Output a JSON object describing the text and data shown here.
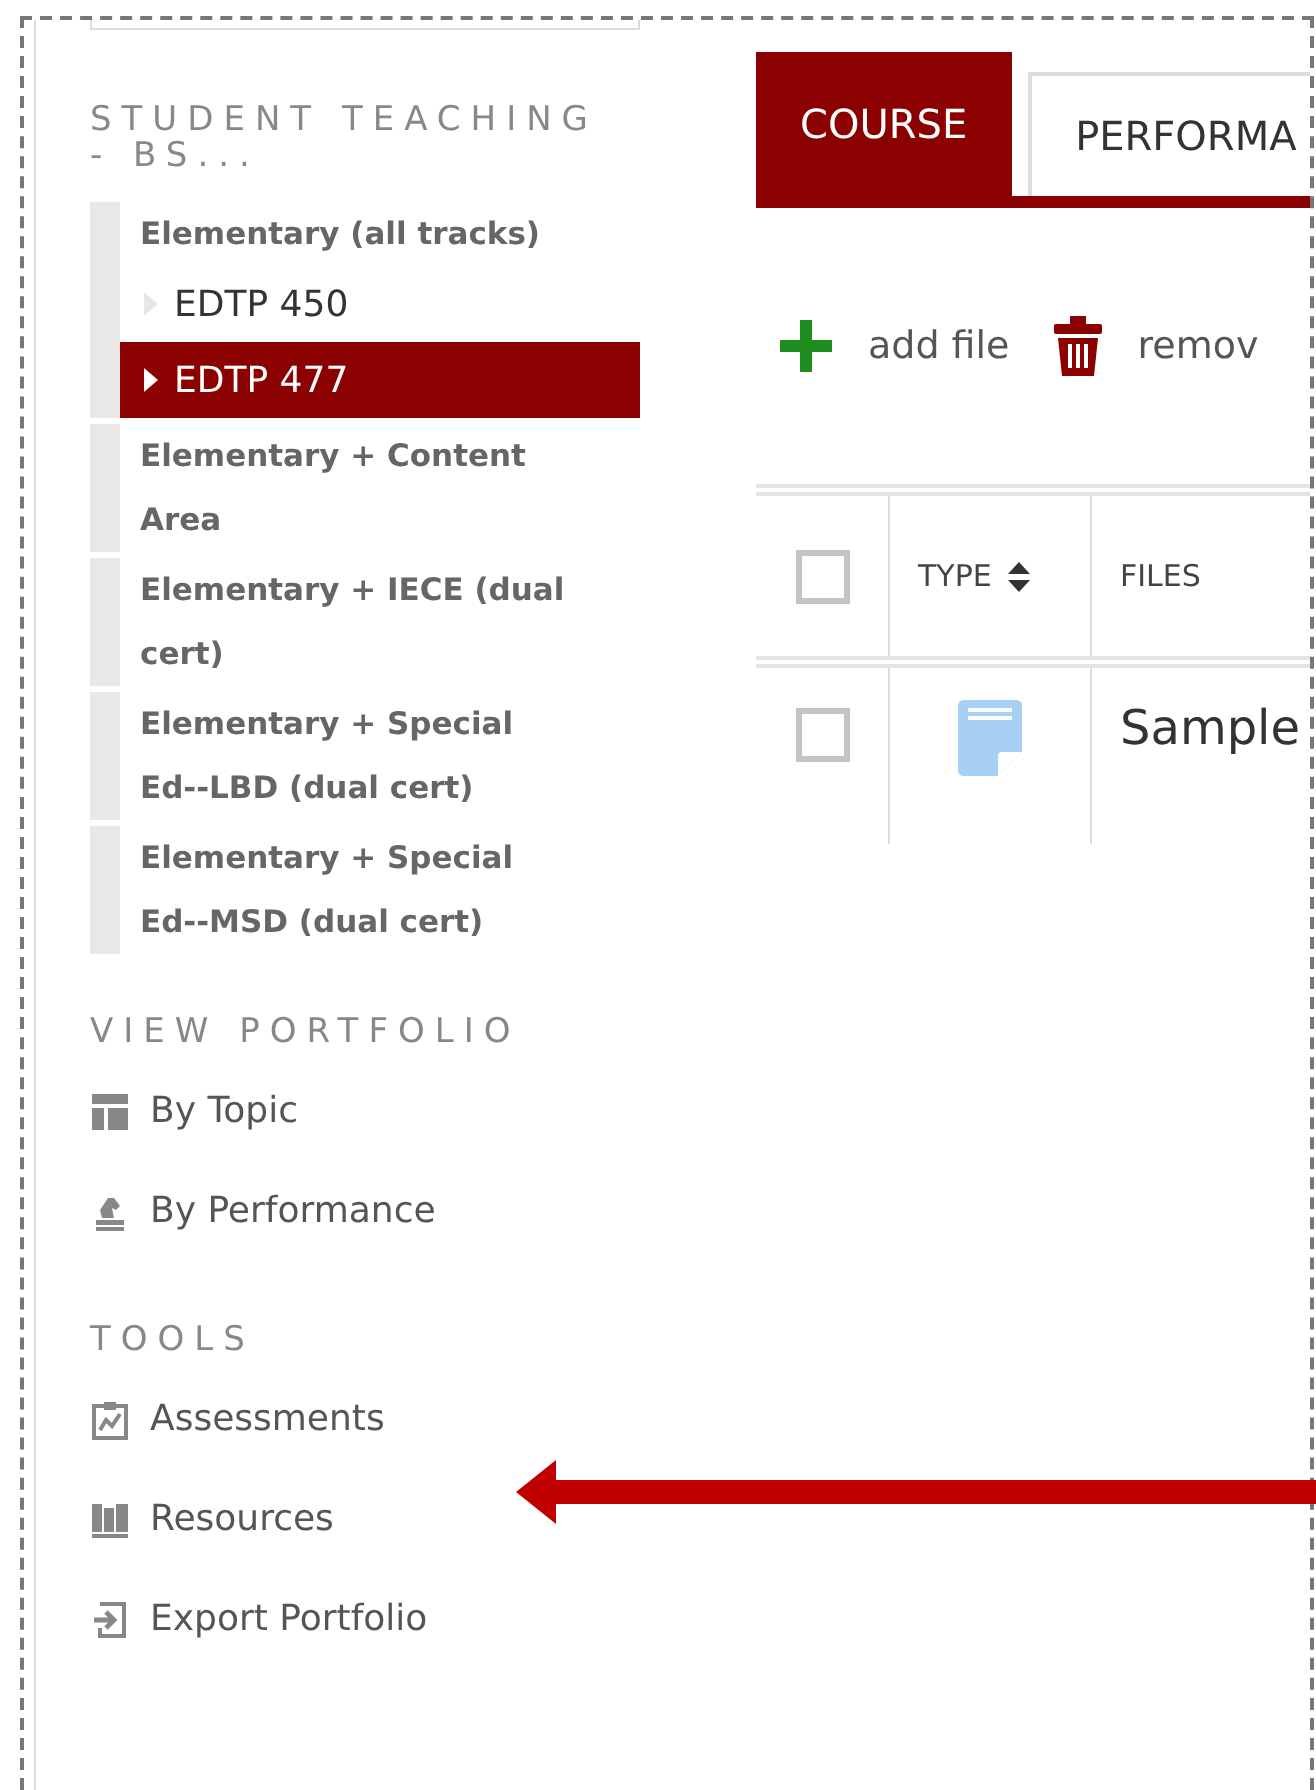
{
  "sidebar": {
    "sections": [
      {
        "heading": "STUDENT TEACHING - BS...",
        "kind": "tree",
        "items": [
          {
            "label": "Elementary (all tracks)",
            "children": [
              {
                "label": "EDTP 450",
                "selected": false
              },
              {
                "label": "EDTP 477",
                "selected": true
              }
            ]
          },
          {
            "label": "Elementary + Content Area"
          },
          {
            "label": "Elementary + IECE (dual cert)"
          },
          {
            "label": "Elementary + Special Ed--LBD (dual cert)"
          },
          {
            "label": "Elementary + Special Ed--MSD (dual cert)"
          }
        ]
      },
      {
        "heading": "VIEW PORTFOLIO",
        "kind": "links",
        "items": [
          {
            "label": "By Topic",
            "kind": "topic"
          },
          {
            "label": "By Performance",
            "kind": "performance"
          }
        ]
      },
      {
        "heading": "TOOLS",
        "kind": "links",
        "items": [
          {
            "label": "Assessments",
            "kind": "assessments"
          },
          {
            "label": "Resources",
            "kind": "resources"
          },
          {
            "label": "Export Portfolio",
            "kind": "export"
          }
        ]
      }
    ]
  },
  "tabs": [
    {
      "label": "COURSE",
      "selected": true
    },
    {
      "label": "PERFORMA",
      "selected": false
    }
  ],
  "toolbar": [
    {
      "label": "add file",
      "kind": "add"
    },
    {
      "label": "remov",
      "kind": "remove"
    }
  ],
  "table": {
    "header_checked": false,
    "columns": [
      {
        "label": "TYPE",
        "sortable": true
      },
      {
        "label": "FILES",
        "sortable": false
      }
    ],
    "rows": [
      {
        "checked": false,
        "kind": "doc",
        "name": "Sample"
      }
    ]
  }
}
